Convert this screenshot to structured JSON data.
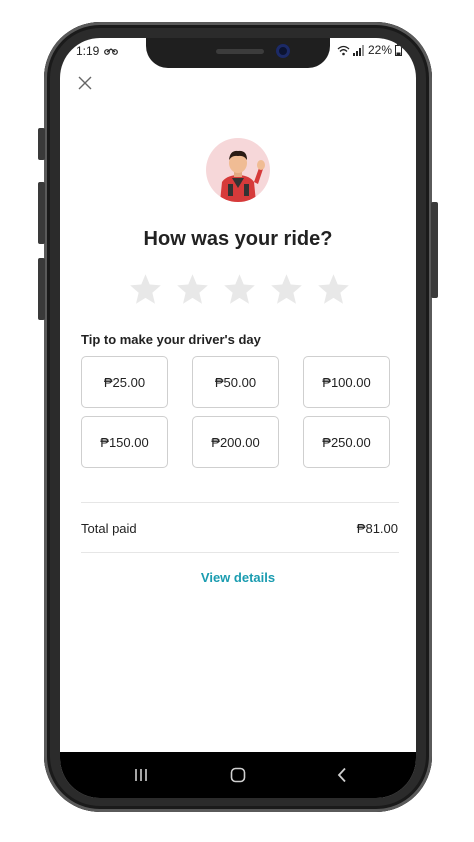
{
  "status_bar": {
    "time": "1:19",
    "battery": "22%"
  },
  "rating": {
    "title": "How was your ride?",
    "stars": 5,
    "selected": 0
  },
  "tip": {
    "title": "Tip to make your driver's day",
    "options": [
      "₱25.00",
      "₱50.00",
      "₱100.00",
      "₱150.00",
      "₱200.00",
      "₱250.00"
    ]
  },
  "summary": {
    "total_label": "Total paid",
    "total_value": "₱81.00",
    "details_link": "View details"
  },
  "colors": {
    "accent": "#1a9cb0",
    "star": "#e8e8e8",
    "avatar_bg": "#f6d7d9"
  },
  "icons": [
    "close-icon",
    "motorbike-icon",
    "wifi-icon",
    "signal-icon",
    "battery-icon",
    "star-icon",
    "recents-icon",
    "home-icon",
    "back-icon"
  ]
}
